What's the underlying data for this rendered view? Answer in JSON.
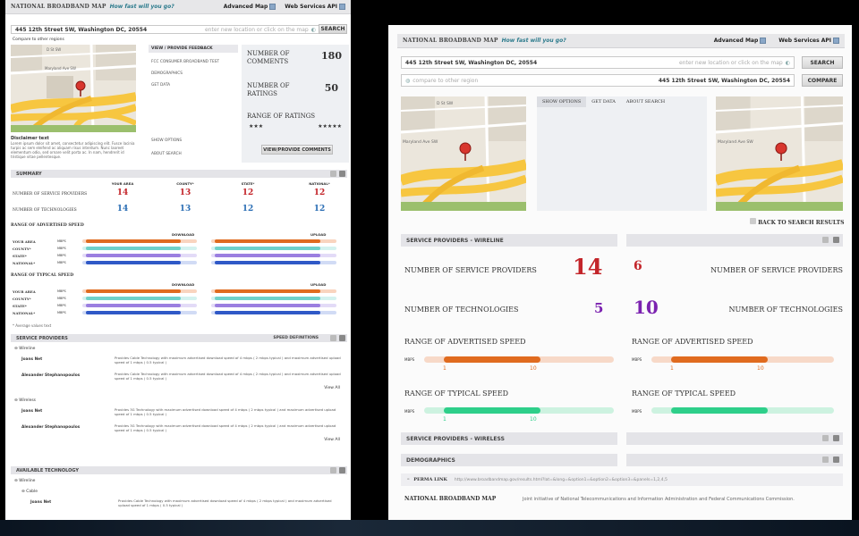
{
  "colors": {
    "accent_teal": "#2b7a8c",
    "red": "#c3252a",
    "blue": "#2c6fb5",
    "purple": "#7b22b0",
    "orange_bar": "#e06b1f",
    "green_bar": "#2ecf8a",
    "teal_bar": "#6fd1c9",
    "blue_bar": "#2f59c7",
    "violet_bar": "#5a2ab0"
  },
  "left": {
    "header": {
      "brand": "National Broadband Map",
      "tagline": "How fast will you go?",
      "advanced_map": "Advanced Map",
      "web_services": "Web Services API"
    },
    "search": {
      "value": "445 12th Street SW, Washington DC, 20554",
      "placeholder": "enter new location or click on the map",
      "button": "SEARCH",
      "compare_link": "Compare to other regions"
    },
    "map_labels": {
      "road1": "Maryland Ave SW",
      "road2": "D St SW",
      "road3": "L'Enfant Promenade"
    },
    "disclaimer": {
      "title": "Disclaimer text",
      "body": "Lorem ipsum dolor sit amet, consectetur adipiscing elit. Fusce lacinia turpis ac sem eleifend ac aliquam risus interdum. Nunc laoreet elementum odio, sed ornare velit porta ac. In nam, hendrerit id tristique vitae pellentesque."
    },
    "menu": {
      "feedback": "VIEW / PROVIDE FEEDBACK",
      "consumer_test": "FCC CONSUMER BROADBAND TEST",
      "demographics": "DEMOGRAPHICS",
      "get_data": "GET DATA",
      "show_options": "SHOW OPTIONS",
      "about_search": "ABOUT SEARCH"
    },
    "stats": {
      "comments_label": "NUMBER OF COMMENTS",
      "comments_value": "180",
      "ratings_label": "NUMBER OF RATINGS",
      "ratings_value": "50",
      "range_label": "RANGE OF RATINGS",
      "stars_low": "★★★",
      "stars_high": "★★★★★",
      "view_btn": "VIEW/PROVIDE COMMENTS"
    },
    "summary": {
      "title": "SUMMARY",
      "cols": [
        "YOUR AREA",
        "COUNTY*",
        "STATE*",
        "NATIONAL*"
      ],
      "rows": [
        {
          "label": "NUMBER OF SERVICE PROVIDERS",
          "values": [
            "14",
            "13",
            "12",
            "12"
          ]
        },
        {
          "label": "NUMBER OF TECHNOLOGIES",
          "values": [
            "14",
            "13",
            "12",
            "12"
          ]
        }
      ]
    },
    "speed": {
      "advertised_title": "RANGE OF ADVERTISED SPEED",
      "typical_title": "RANGE OF TYPICAL SPEED",
      "download": "DOWNLOAD",
      "upload": "UPLOAD",
      "unit": "MBPS",
      "rows": [
        "YOUR AREA",
        "COUNTY*",
        "STATE*",
        "NATIONAL*"
      ],
      "footnote": "* Average values text"
    },
    "providers": {
      "title": "SERVICE PROVIDERS",
      "speed_defs": "SPEED DEFINITIONS",
      "wireline": "Wireline",
      "wireless": "Wireless",
      "view_all": "View All",
      "wireline_items": [
        {
          "name": "Joans Net",
          "text": "Provides Cable Technology with maximum advertised download speed of 4 mbps ( 2 mbps typical ) and maximum advertised upload speed of 1 mbps ( 0.5 typical )"
        },
        {
          "name": "Alexander Stephanopoulos",
          "text": "Provides Cable Technology with maximum advertised download speed of 4 mbps ( 2 mbps typical ) and maximum advertised upload speed of 1 mbps ( 0.5 typical )"
        }
      ],
      "wireless_items": [
        {
          "name": "Joans Net",
          "text": "Provides 3G Technology with maximum advertised download speed of 4 mbps ( 2 mbps typical ) and maximum advertised upload speed of 1 mbps ( 0.5 typical )"
        },
        {
          "name": "Alexander Stephanopoulos",
          "text": "Provides 3G Technology with maximum advertised download speed of 4 mbps ( 2 mbps typical ) and maximum advertised upload speed of 1 mbps ( 0.5 typical )"
        }
      ]
    },
    "technology": {
      "title": "AVAILABLE TECHNOLOGY",
      "wireline": "Wireline",
      "cable": "Cable",
      "item_name": "Joans Net",
      "item_text": "Provides Cable Technology with maximum advertised download speed of 4 mbps ( 2 mbps typical ) and maximum advertised upload speed of 1 mbps ( 0.5 typical )"
    }
  },
  "right": {
    "header": {
      "brand": "National Broadband Map",
      "tagline": "How fast will you go?",
      "advanced_map": "Advanced Map",
      "web_services": "Web Services API"
    },
    "search": {
      "value": "445 12th Street SW, Washington DC, 20554",
      "placeholder": "enter new location or click on the map",
      "button": "SEARCH"
    },
    "compare": {
      "placeholder": "compare to other region",
      "value": "445 12th Street SW, Washington DC, 20554",
      "button": "COMPARE"
    },
    "tabs": [
      "SHOW OPTIONS",
      "GET DATA",
      "ABOUT SEARCH"
    ],
    "back": "BACK TO SEARCH RESULTS",
    "wireline_title": "SERVICE PROVIDERS - WIRELINE",
    "left_col": {
      "providers_label": "NUMBER OF SERVICE PROVIDERS",
      "providers_value": "14",
      "tech_label": "NUMBER OF TECHNOLOGIES",
      "tech_value": "5",
      "adv_label": "RANGE OF ADVERTISED SPEED",
      "adv_min": "1",
      "adv_max": "10",
      "typ_label": "RANGE OF TYPICAL SPEED",
      "typ_min": "1",
      "typ_max": "10"
    },
    "right_col": {
      "providers_label": "NUMBER OF SERVICE PROVIDERS",
      "providers_value": "6",
      "tech_label": "NUMBER OF TECHNOLOGIES",
      "tech_value": "10",
      "adv_label": "RANGE OF ADVERTISED SPEED",
      "adv_min": "1",
      "adv_max": "10",
      "typ_label": "RANGE OF TYPICAL SPEED",
      "typ_min": "1",
      "typ_max": "10"
    },
    "unit": "MBPS",
    "wireless_title": "SERVICE PROVIDERS - WIRELESS",
    "demographics_title": "DEMOGRAPHICS",
    "permalink_label": "PERMA LINK",
    "permalink_url": "http://www.broadbandmap.gov/results.html?lat=&long=&option1=&option2=&option3=&panels=1,2,4,5",
    "footer_brand": "NATIONAL BROADBAND MAP",
    "footer_text": "Joint initiative of National Telecommunications and Information Administration and Federal Communications Commission."
  }
}
